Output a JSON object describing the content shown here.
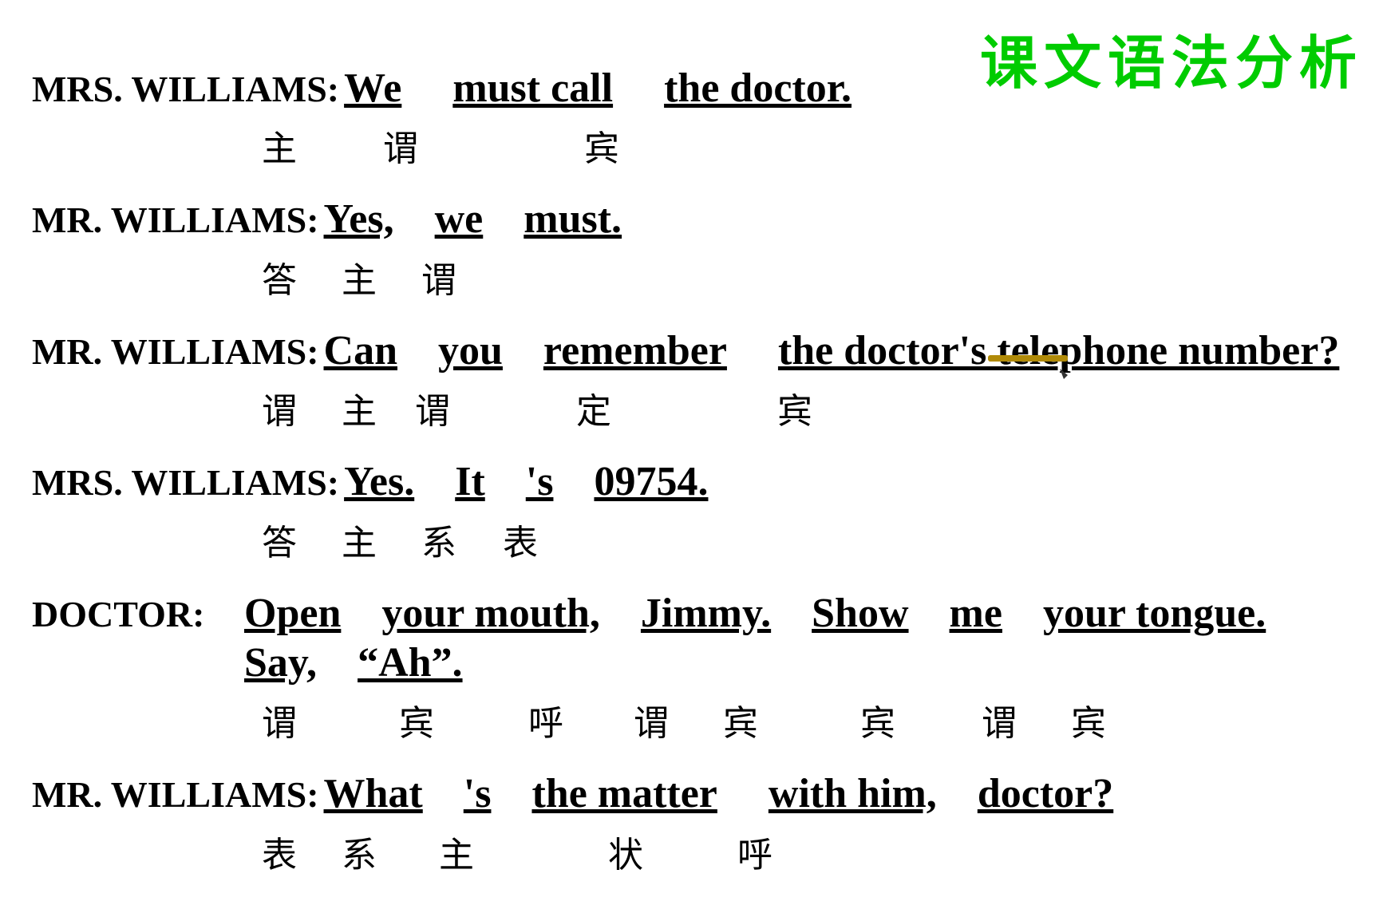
{
  "watermark": {
    "text": "课文语法分析"
  },
  "sentences": [
    {
      "id": "s1",
      "speaker": "MRS. WILLIAMS:",
      "english": [
        {
          "text": "We",
          "underline": true
        },
        {
          "text": "must call",
          "underline": true
        },
        {
          "text": "the doctor.",
          "underline": true
        }
      ],
      "grammar": [
        "主",
        "谓",
        "宾"
      ]
    },
    {
      "id": "s2",
      "speaker": "MR. WILLIAMS:",
      "english": [
        {
          "text": "Yes,",
          "underline": true
        },
        {
          "text": "we",
          "underline": true
        },
        {
          "text": "must.",
          "underline": true
        }
      ],
      "grammar": [
        "答",
        "主",
        "谓"
      ]
    },
    {
      "id": "s3",
      "speaker": "MR. WILLIAMS:",
      "english": [
        {
          "text": "Can",
          "underline": true
        },
        {
          "text": "you",
          "underline": true
        },
        {
          "text": "remember",
          "underline": true
        },
        {
          "text": "the doctor's telephone number?",
          "underline": true
        }
      ],
      "grammar": [
        "谓",
        "主",
        "谓",
        "定",
        "宾"
      ]
    },
    {
      "id": "s4",
      "speaker": "MRS. WILLIAMS:",
      "english": [
        {
          "text": "Yes.",
          "underline": true
        },
        {
          "text": "It",
          "underline": true
        },
        {
          "text": "'s",
          "underline": true
        },
        {
          "text": "09754.",
          "underline": true
        }
      ],
      "grammar": [
        "答",
        "主",
        "系",
        "表"
      ]
    },
    {
      "id": "s5",
      "speaker": "DOCTOR:",
      "english": [
        {
          "text": "Open",
          "underline": true
        },
        {
          "text": "your mouth,",
          "underline": true
        },
        {
          "text": "Jimmy.",
          "underline": true
        },
        {
          "text": "Show",
          "underline": true
        },
        {
          "text": "me",
          "underline": true
        },
        {
          "text": "your tongue.",
          "underline": true
        },
        {
          "text": "Say,",
          "underline": true
        },
        {
          "text": "“Ah”.",
          "underline": true
        }
      ],
      "grammar": [
        "谓",
        "宾",
        "呼",
        "谓",
        "宾",
        "宾",
        "谓",
        "宾"
      ]
    },
    {
      "id": "s6",
      "speaker": "MR. WILLIAMS:",
      "english": [
        {
          "text": "What",
          "underline": true
        },
        {
          "text": "'s",
          "underline": true
        },
        {
          "text": "the matter",
          "underline": true
        },
        {
          "text": "with him,",
          "underline": true
        },
        {
          "text": "doctor?",
          "underline": true
        }
      ],
      "grammar": [
        "表",
        "系",
        "主",
        "状",
        "呼"
      ]
    }
  ]
}
